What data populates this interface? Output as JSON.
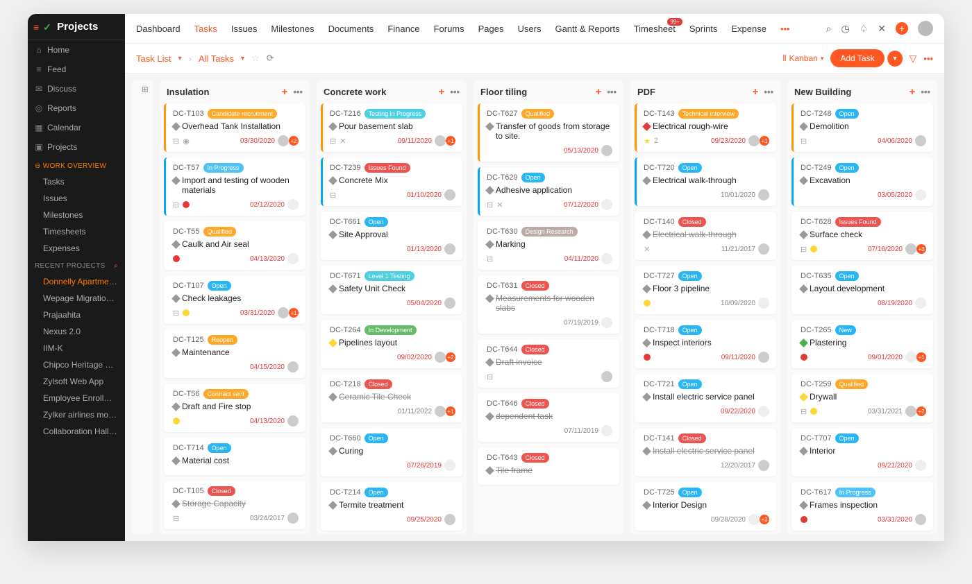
{
  "app_title": "Projects",
  "topnav": [
    "Dashboard",
    "Tasks",
    "Issues",
    "Milestones",
    "Documents",
    "Finance",
    "Forums",
    "Pages",
    "Users",
    "Gantt & Reports",
    "Timesheet",
    "Sprints",
    "Expense"
  ],
  "topnav_active": 1,
  "timesheet_badge": "99+",
  "sidebar": {
    "main": [
      {
        "icon": "⌂",
        "label": "Home"
      },
      {
        "icon": "≡",
        "label": "Feed"
      },
      {
        "icon": "✉",
        "label": "Discuss"
      },
      {
        "icon": "◎",
        "label": "Reports"
      },
      {
        "icon": "▦",
        "label": "Calendar"
      },
      {
        "icon": "▣",
        "label": "Projects"
      }
    ],
    "overview_label": "WORK OVERVIEW",
    "overview": [
      "Tasks",
      "Issues",
      "Milestones",
      "Timesheets",
      "Expenses"
    ],
    "recent_label": "RECENT PROJECTS",
    "recent": [
      "Donnelly Apartments C",
      "Wepage Migration Pha",
      "Prajaahita",
      "Nexus 2.0",
      "IIM-K",
      "Chipco Heritage Bay",
      "Zylsoft Web App",
      "Employee Enrollment",
      "Zylker airlines mobile a",
      "Collaboration Hall Con"
    ]
  },
  "breadcrumb": {
    "task_list": "Task List",
    "all_tasks": "All Tasks"
  },
  "view_label": "Kanban",
  "add_task": "Add Task",
  "columns": [
    {
      "title": "Insulation",
      "cards": [
        {
          "id": "DC-T103",
          "tag": "Candidate recruitment",
          "tagc": "orange",
          "title": "Overhead Tank Installation",
          "date": "03/30/2020",
          "dred": true,
          "prio": "",
          "icons": [
            "sub",
            "chat"
          ],
          "av": true,
          "badge": "+2",
          "bl": "orange"
        },
        {
          "id": "DC-T57",
          "tag": "In Progress",
          "tagc": "lblue",
          "title": "Import and testing of wooden materials",
          "date": "02/12/2020",
          "dred": true,
          "prio": "red",
          "icons": [
            "sub"
          ],
          "bl": "blue"
        },
        {
          "id": "DC-T55",
          "tag": "Qualified",
          "tagc": "orange",
          "title": "Caulk and Air seal",
          "date": "04/13/2020",
          "dred": true,
          "prio": "red",
          "bl": "none"
        },
        {
          "id": "DC-T107",
          "tag": "Open",
          "tagc": "blue",
          "title": "Check leakages",
          "date": "03/31/2020",
          "dred": true,
          "prio": "yellow",
          "icons": [
            "sub"
          ],
          "av": true,
          "badge": "+1",
          "bl": "none"
        },
        {
          "id": "DC-T125",
          "tag": "Reopen",
          "tagc": "orange",
          "title": "Maintenance",
          "date": "04/15/2020",
          "dred": true,
          "av": true,
          "bl": "none"
        },
        {
          "id": "DC-T56",
          "tag": "Contract sent",
          "tagc": "orange",
          "title": "Draft and Fire stop",
          "date": "04/13/2020",
          "dred": true,
          "prio": "yellow",
          "av": true,
          "bl": "none"
        },
        {
          "id": "DC-T714",
          "tag": "Open",
          "tagc": "blue",
          "title": "Material cost",
          "date": "",
          "bl": "none"
        },
        {
          "id": "DC-T105",
          "tag": "Closed",
          "tagc": "red",
          "title": "Storage Capacity",
          "strike": true,
          "date": "03/24/2017",
          "dred": false,
          "icons": [
            "sub"
          ],
          "av": true,
          "bl": "none"
        }
      ]
    },
    {
      "title": "Concrete work",
      "cards": [
        {
          "id": "DC-T216",
          "tag": "Testing in Progress",
          "tagc": "teal",
          "title": "Pour basement slab",
          "date": "09/11/2020",
          "dred": true,
          "icons": [
            "sub",
            "x"
          ],
          "av": true,
          "badge": "+1",
          "bl": "orange"
        },
        {
          "id": "DC-T239",
          "tag": "Issues Found",
          "tagc": "red",
          "title": "Concrete Mix",
          "date": "01/10/2020",
          "dred": true,
          "icons": [
            "sub"
          ],
          "av": true,
          "bl": "blue"
        },
        {
          "id": "DC-T661",
          "tag": "Open",
          "tagc": "blue",
          "title": "Site Approval",
          "date": "01/13/2020",
          "dred": true,
          "av": true,
          "bl": "none"
        },
        {
          "id": "DC-T671",
          "tag": "Level 1 Testing",
          "tagc": "teal",
          "title": "Safety Unit Check",
          "date": "05/04/2020",
          "dred": true,
          "av": true,
          "bl": "none"
        },
        {
          "id": "DC-T264",
          "tag": "In Development",
          "tagc": "green",
          "title": "Pipelines layout",
          "date": "09/02/2020",
          "dred": true,
          "dia": "yellow",
          "av": true,
          "badge": "+2",
          "bl": "none"
        },
        {
          "id": "DC-T218",
          "tag": "Closed",
          "tagc": "red",
          "title": "Ceramic Tile Check",
          "strike": true,
          "date": "01/11/2022",
          "dred": false,
          "av": true,
          "badge": "+1",
          "bl": "none"
        },
        {
          "id": "DC-T660",
          "tag": "Open",
          "tagc": "blue",
          "title": "Curing",
          "date": "07/26/2019",
          "dred": true,
          "bl": "none"
        },
        {
          "id": "DC-T214",
          "tag": "Open",
          "tagc": "blue",
          "title": "Termite treatment",
          "date": "09/25/2020",
          "dred": true,
          "av": true,
          "bl": "none"
        }
      ]
    },
    {
      "title": "Floor tiling",
      "cards": [
        {
          "id": "DC-T627",
          "tag": "Qualified",
          "tagc": "orange",
          "title": "Transfer of goods from storage to site.",
          "date": "05/13/2020",
          "dred": true,
          "av": true,
          "bl": "orange"
        },
        {
          "id": "DC-T629",
          "tag": "Open",
          "tagc": "blue",
          "title": "Adhesive application",
          "date": "07/12/2020",
          "dred": true,
          "icons": [
            "sub",
            "x"
          ],
          "bl": "blue"
        },
        {
          "id": "DC-T630",
          "tag": "Design Research",
          "tagc": "brown",
          "title": "Marking",
          "date": "04/11/2020",
          "dred": true,
          "icons": [
            "sub"
          ],
          "bl": "none"
        },
        {
          "id": "DC-T631",
          "tag": "Closed",
          "tagc": "red",
          "title": "Measurements for wooden slabs",
          "strike": true,
          "date": "07/19/2019",
          "dred": false,
          "bl": "none"
        },
        {
          "id": "DC-T644",
          "tag": "Closed",
          "tagc": "red",
          "title": "Draft invoice",
          "strike": true,
          "date": "",
          "icons": [
            "sub"
          ],
          "av": true,
          "bl": "none"
        },
        {
          "id": "DC-T646",
          "tag": "Closed",
          "tagc": "red",
          "title": "dependent task",
          "strike": true,
          "date": "07/11/2019",
          "dred": false,
          "bl": "none"
        },
        {
          "id": "DC-T643",
          "tag": "Closed",
          "tagc": "red",
          "title": "Tile frame",
          "strike": true,
          "date": "",
          "bl": "none"
        }
      ]
    },
    {
      "title": "PDF",
      "cards": [
        {
          "id": "DC-T143",
          "tag": "Technical interview",
          "tagc": "orange",
          "title": "Electrical rough-wire",
          "dia": "red",
          "date": "09/23/2020",
          "dred": true,
          "icons": [
            "star",
            "2"
          ],
          "av": true,
          "badge": "+1",
          "bl": "orange"
        },
        {
          "id": "DC-T720",
          "tag": "Open",
          "tagc": "blue",
          "title": "Electrical walk-through",
          "date": "10/01/2020",
          "dred": false,
          "av": true,
          "bl": "blue"
        },
        {
          "id": "DC-T140",
          "tag": "Closed",
          "tagc": "red",
          "title": "Electrical walk-through",
          "strike": true,
          "date": "11/21/2017",
          "dred": false,
          "icons": [
            "x"
          ],
          "av": true,
          "bl": "none"
        },
        {
          "id": "DC-T727",
          "tag": "Open",
          "tagc": "blue",
          "title": "Floor 3 pipeline",
          "date": "10/09/2020",
          "dred": false,
          "prio": "yellow",
          "bl": "none"
        },
        {
          "id": "DC-T718",
          "tag": "Open",
          "tagc": "blue",
          "title": "Inspect interiors",
          "date": "09/11/2020",
          "dred": true,
          "prio": "red",
          "av": true,
          "bl": "none"
        },
        {
          "id": "DC-T721",
          "tag": "Open",
          "tagc": "blue",
          "title": "Install electric service panel",
          "date": "09/22/2020",
          "dred": true,
          "bl": "none"
        },
        {
          "id": "DC-T141",
          "tag": "Closed",
          "tagc": "red",
          "title": "Install electric service panel",
          "strike": true,
          "date": "12/20/2017",
          "dred": false,
          "av": true,
          "bl": "none"
        },
        {
          "id": "DC-T725",
          "tag": "Open",
          "tagc": "blue",
          "title": "Interior Design",
          "date": "09/28/2020",
          "dred": false,
          "badge": "+3",
          "bl": "none"
        }
      ]
    },
    {
      "title": "New Building",
      "cards": [
        {
          "id": "DC-T248",
          "tag": "Open",
          "tagc": "blue",
          "title": "Demolition",
          "date": "04/06/2020",
          "dred": true,
          "icons": [
            "sub"
          ],
          "av": true,
          "bl": "orange"
        },
        {
          "id": "DC-T249",
          "tag": "Open",
          "tagc": "blue",
          "title": "Excavation",
          "date": "03/05/2020",
          "dred": true,
          "bl": "blue"
        },
        {
          "id": "DC-T628",
          "tag": "Issues Found",
          "tagc": "red",
          "title": "Surface check",
          "date": "07/16/2020",
          "dred": true,
          "prio": "yellow",
          "icons": [
            "sub"
          ],
          "av": true,
          "badge": "+3",
          "bl": "none"
        },
        {
          "id": "DC-T635",
          "tag": "Open",
          "tagc": "blue",
          "title": "Layout development",
          "date": "08/19/2020",
          "dred": true,
          "bl": "none"
        },
        {
          "id": "DC-T265",
          "tag": "New",
          "tagc": "blue",
          "title": "Plastering",
          "dia": "green",
          "date": "09/01/2020",
          "dred": true,
          "prio": "red",
          "badge": "+1",
          "bl": "none"
        },
        {
          "id": "DC-T259",
          "tag": "Qualified",
          "tagc": "orange",
          "title": "Drywall",
          "dia": "yellow",
          "date": "03/31/2021",
          "dred": false,
          "prio": "yellow",
          "icons": [
            "sub"
          ],
          "av": true,
          "badge": "+2",
          "bl": "none"
        },
        {
          "id": "DC-T707",
          "tag": "Open",
          "tagc": "blue",
          "title": "Interior",
          "date": "09/21/2020",
          "dred": true,
          "bl": "none"
        },
        {
          "id": "DC-T617",
          "tag": "In Progress",
          "tagc": "lblue",
          "title": "Frames inspection",
          "date": "03/31/2020",
          "dred": true,
          "prio": "red",
          "av": true,
          "bl": "none"
        }
      ]
    }
  ]
}
